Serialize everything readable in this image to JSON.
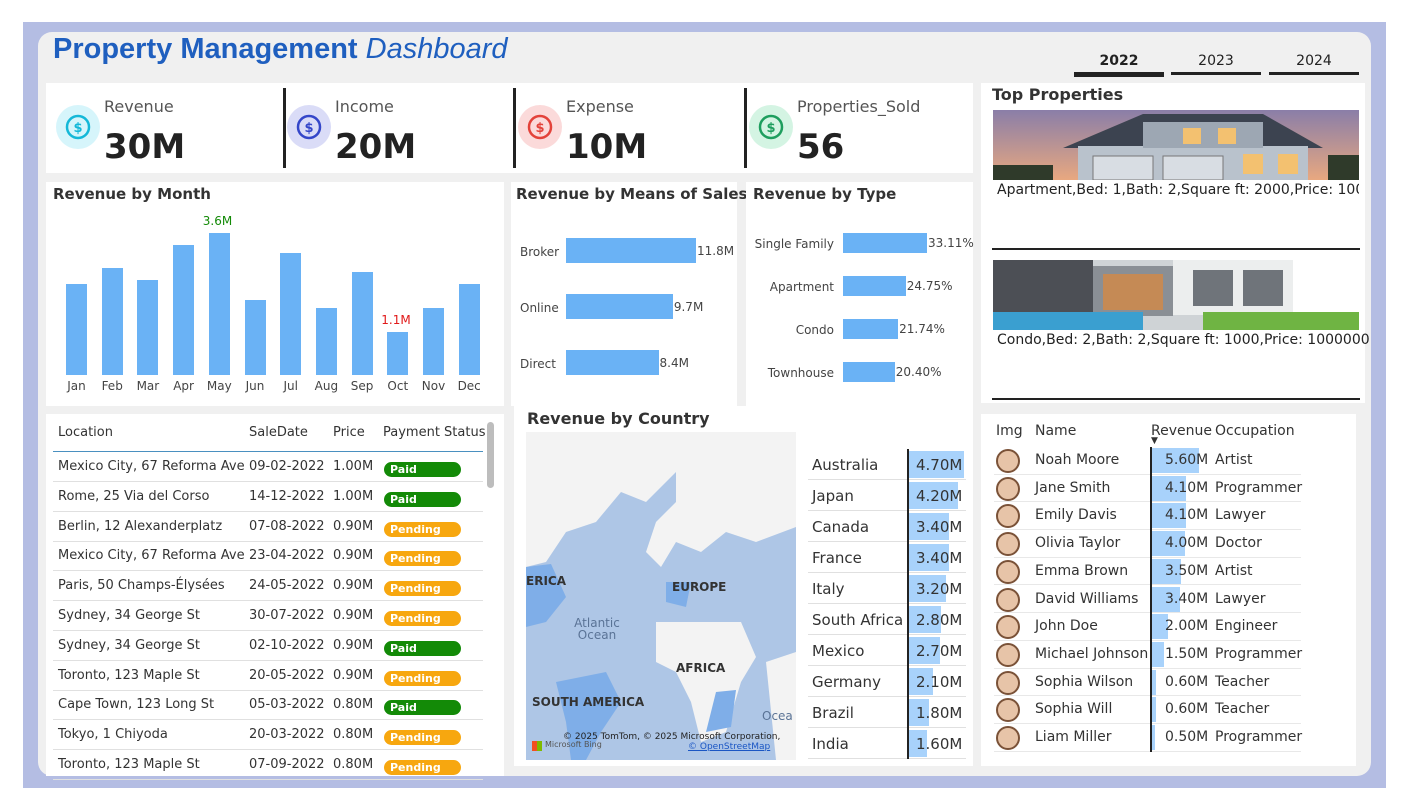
{
  "header": {
    "title_bold": "Property Management",
    "title_italic": "Dashboard"
  },
  "years": [
    {
      "label": "2022",
      "active": true
    },
    {
      "label": "2023",
      "active": false
    },
    {
      "label": "2024",
      "active": false
    }
  ],
  "kpis": [
    {
      "label": "Revenue",
      "value": "30M",
      "icon": "hand-money-icon",
      "color": "#14b8d8",
      "bg": "#d6f5fb"
    },
    {
      "label": "Income",
      "value": "20M",
      "icon": "income-coin-icon",
      "color": "#3446c9",
      "bg": "#dadcf7"
    },
    {
      "label": "Expense",
      "value": "10M",
      "icon": "expense-coin-icon",
      "color": "#e3423a",
      "bg": "#fbdada"
    },
    {
      "label": "Properties_Sold",
      "value": "56",
      "icon": "hand-house-icon",
      "color": "#1e9e5e",
      "bg": "#d4f4e3"
    }
  ],
  "revenue_by_month": {
    "title": "Revenue by Month",
    "max_label": "3.6M",
    "min_label": "1.1M"
  },
  "means_of_sales": {
    "title": "Revenue by Means of Sales"
  },
  "by_type": {
    "title": "Revenue by Type"
  },
  "top_properties": {
    "title": "Top Properties",
    "items": [
      {
        "caption": "Apartment,Bed: 1,Bath: 2,Square ft: 2000,Price: 100000"
      },
      {
        "caption": "Condo,Bed: 2,Bath: 2,Square ft: 1000,Price: 1000000"
      }
    ]
  },
  "sales_table": {
    "columns": [
      "Location",
      "SaleDate",
      "Price",
      "Payment Status"
    ],
    "rows": [
      [
        "Mexico City, 67 Reforma Ave",
        "09-02-2022",
        "1.00M",
        "Paid"
      ],
      [
        "Rome, 25 Via del Corso",
        "14-12-2022",
        "1.00M",
        "Paid"
      ],
      [
        "Berlin, 12 Alexanderplatz",
        "07-08-2022",
        "0.90M",
        "Pending"
      ],
      [
        "Mexico City, 67 Reforma Ave",
        "23-04-2022",
        "0.90M",
        "Pending"
      ],
      [
        "Paris, 50 Champs-Élysées",
        "24-05-2022",
        "0.90M",
        "Pending"
      ],
      [
        "Sydney, 34 George St",
        "30-07-2022",
        "0.90M",
        "Pending"
      ],
      [
        "Sydney, 34 George St",
        "02-10-2022",
        "0.90M",
        "Paid"
      ],
      [
        "Toronto, 123 Maple St",
        "20-05-2022",
        "0.90M",
        "Pending"
      ],
      [
        "Cape Town, 123 Long St",
        "05-03-2022",
        "0.80M",
        "Paid"
      ],
      [
        "Tokyo, 1 Chiyoda",
        "20-03-2022",
        "0.80M",
        "Pending"
      ],
      [
        "Toronto, 123 Maple St",
        "07-09-2022",
        "0.80M",
        "Pending"
      ]
    ],
    "status_colors": {
      "Paid": "#138a07",
      "Pending": "#f7a70f"
    }
  },
  "country": {
    "title": "Revenue by Country",
    "map_labels": [
      "ERICA",
      "EUROPE",
      "Atlantic Ocean",
      "AFRICA",
      "SOUTH AMERICA",
      "Ocea"
    ],
    "attribution": "© 2025 TomTom, © 2025 Microsoft Corporation,",
    "osm": "© OpenStreetMap",
    "bing": "Microsoft Bing"
  },
  "people": {
    "columns": [
      "Img",
      "Name",
      "Revenue",
      "Occupation"
    ],
    "rows": [
      {
        "name": "Noah Moore",
        "revenue": 5.6,
        "revenue_label": "5.60M",
        "occupation": "Artist"
      },
      {
        "name": "Jane Smith",
        "revenue": 4.1,
        "revenue_label": "4.10M",
        "occupation": "Programmer"
      },
      {
        "name": "Emily Davis",
        "revenue": 4.1,
        "revenue_label": "4.10M",
        "occupation": "Lawyer"
      },
      {
        "name": "Olivia Taylor",
        "revenue": 4.0,
        "revenue_label": "4.00M",
        "occupation": "Doctor"
      },
      {
        "name": "Emma Brown",
        "revenue": 3.5,
        "revenue_label": "3.50M",
        "occupation": "Artist"
      },
      {
        "name": "David Williams",
        "revenue": 3.4,
        "revenue_label": "3.40M",
        "occupation": "Lawyer"
      },
      {
        "name": "John Doe",
        "revenue": 2.0,
        "revenue_label": "2.00M",
        "occupation": "Engineer"
      },
      {
        "name": "Michael Johnson",
        "revenue": 1.5,
        "revenue_label": "1.50M",
        "occupation": "Programmer"
      },
      {
        "name": "Sophia Wilson",
        "revenue": 0.6,
        "revenue_label": "0.60M",
        "occupation": "Teacher"
      },
      {
        "name": "Sophia Will",
        "revenue": 0.6,
        "revenue_label": "0.60M",
        "occupation": "Teacher"
      },
      {
        "name": "Liam Miller",
        "revenue": 0.5,
        "revenue_label": "0.50M",
        "occupation": "Programmer"
      }
    ]
  },
  "chart_data": [
    {
      "type": "bar",
      "title": "Revenue by Month",
      "categories": [
        "Jan",
        "Feb",
        "Mar",
        "Apr",
        "May",
        "Jun",
        "Jul",
        "Aug",
        "Sep",
        "Oct",
        "Nov",
        "Dec"
      ],
      "values": [
        2.3,
        2.7,
        2.4,
        3.3,
        3.6,
        1.9,
        3.1,
        1.7,
        2.6,
        1.1,
        1.7,
        2.3
      ],
      "data_labels": {
        "4": "3.6M",
        "9": "1.1M"
      },
      "ylim": [
        0,
        3.8
      ]
    },
    {
      "type": "bar",
      "title": "Revenue by Means of Sales",
      "categories": [
        "Broker",
        "Online",
        "Direct"
      ],
      "values": [
        11.8,
        9.7,
        8.4
      ],
      "labels": [
        "11.8M",
        "9.7M",
        "8.4M"
      ]
    },
    {
      "type": "bar",
      "title": "Revenue by Type",
      "categories": [
        "Single Family",
        "Apartment",
        "Condo",
        "Townhouse"
      ],
      "values": [
        33.11,
        24.75,
        21.74,
        20.4
      ],
      "labels": [
        "33.11%",
        "24.75%",
        "21.74%",
        "20.40%"
      ]
    },
    {
      "type": "bar",
      "title": "Revenue by Country",
      "categories": [
        "Australia",
        "Japan",
        "Canada",
        "France",
        "Italy",
        "South Africa",
        "Mexico",
        "Germany",
        "Brazil",
        "India"
      ],
      "values": [
        4.7,
        4.2,
        3.4,
        3.4,
        3.2,
        2.8,
        2.7,
        2.1,
        1.8,
        1.6
      ],
      "labels": [
        "4.70M",
        "4.20M",
        "3.40M",
        "3.40M",
        "3.20M",
        "2.80M",
        "2.70M",
        "2.10M",
        "1.80M",
        "1.60M"
      ]
    }
  ]
}
